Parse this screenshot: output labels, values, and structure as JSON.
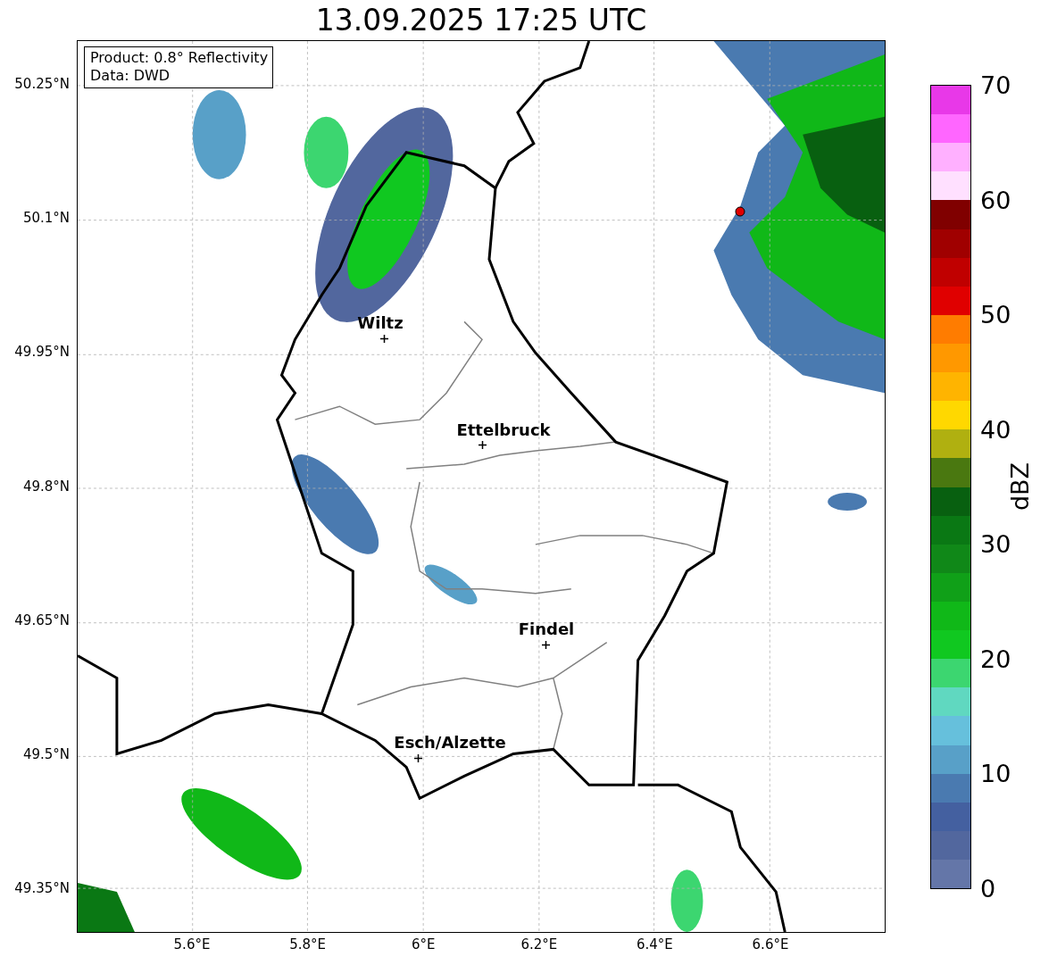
{
  "title": "13.09.2025 17:25 UTC",
  "info_box": [
    "Product: 0.8° Reflectivity",
    "Data: DWD"
  ],
  "lat_ticks": [
    "50.25°N",
    "50.1°N",
    "49.95°N",
    "49.8°N",
    "49.65°N",
    "49.5°N",
    "49.35°N"
  ],
  "lon_ticks": [
    "5.6°E",
    "5.8°E",
    "6°E",
    "6.2°E",
    "6.4°E",
    "6.6°E"
  ],
  "cities": [
    {
      "name": "Wiltz"
    },
    {
      "name": "Ettelbruck"
    },
    {
      "name": "Findel"
    },
    {
      "name": "Esch/Alzette"
    }
  ],
  "colorbar": {
    "label": "dBZ",
    "ticks": [
      "70",
      "60",
      "50",
      "40",
      "30",
      "20",
      "10",
      "0"
    ],
    "bins": [
      {
        "color": "#e838e8"
      },
      {
        "color": "#ff66ff"
      },
      {
        "color": "#ffb0ff"
      },
      {
        "color": "#ffe0ff"
      },
      {
        "color": "#800000"
      },
      {
        "color": "#a00000"
      },
      {
        "color": "#c00000"
      },
      {
        "color": "#e00000"
      },
      {
        "color": "#ff7c00"
      },
      {
        "color": "#ff9800"
      },
      {
        "color": "#ffb400"
      },
      {
        "color": "#ffd800"
      },
      {
        "color": "#b0b010"
      },
      {
        "color": "#4a7810"
      },
      {
        "color": "#086010"
      },
      {
        "color": "#0a7814"
      },
      {
        "color": "#108818"
      },
      {
        "color": "#10a018"
      },
      {
        "color": "#10b818"
      },
      {
        "color": "#10c820"
      },
      {
        "color": "#3cd670"
      },
      {
        "color": "#60d8c0"
      },
      {
        "color": "#66c0dc"
      },
      {
        "color": "#58a0c8"
      },
      {
        "color": "#4a7ab0"
      },
      {
        "color": "#4460a0"
      },
      {
        "color": "#52679e"
      },
      {
        "color": "#6476a8"
      }
    ]
  }
}
